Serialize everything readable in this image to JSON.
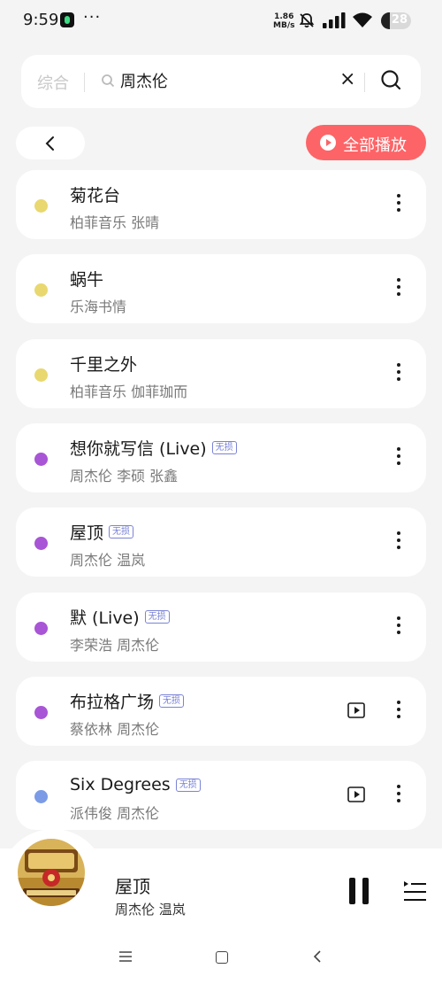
{
  "status": {
    "time": "9:59",
    "dots": "···",
    "speed_top": "1.86",
    "speed_bottom": "MB/s",
    "battery": "28"
  },
  "search": {
    "category": "综合",
    "query": "周杰伦"
  },
  "toolbar": {
    "play_all": "全部播放"
  },
  "colors": {
    "accent": "#fd6467",
    "badge": "#7a83d6",
    "dot_yellow": "#e8d86f",
    "dot_purple": "#a855d6",
    "dot_blue": "#7b9be6"
  },
  "songs": [
    {
      "title": "菊花台",
      "artist": "柏菲音乐 张晴",
      "badge": "",
      "dot": "#e8d86f",
      "mv": false
    },
    {
      "title": "蜗牛",
      "artist": "乐海书情",
      "badge": "",
      "dot": "#e8d86f",
      "mv": false
    },
    {
      "title": "千里之外",
      "artist": "柏菲音乐 伽菲珈而",
      "badge": "",
      "dot": "#e8d86f",
      "mv": false
    },
    {
      "title": "想你就写信 (Live)",
      "artist": "周杰伦 李硕 张鑫",
      "badge": "无损",
      "dot": "#a855d6",
      "mv": false
    },
    {
      "title": "屋顶",
      "artist": "周杰伦 温岚",
      "badge": "无损",
      "dot": "#a855d6",
      "mv": false
    },
    {
      "title": "默 (Live)",
      "artist": "李荣浩 周杰伦",
      "badge": "无损",
      "dot": "#a855d6",
      "mv": false
    },
    {
      "title": "布拉格广场",
      "artist": "蔡依林 周杰伦",
      "badge": "无损",
      "dot": "#a855d6",
      "mv": true
    },
    {
      "title": "Six Degrees",
      "artist": "派伟俊 周杰伦",
      "badge": "无损",
      "dot": "#7b9be6",
      "mv": true
    }
  ],
  "player": {
    "title": "屋顶",
    "artist": "周杰伦 温岚"
  }
}
